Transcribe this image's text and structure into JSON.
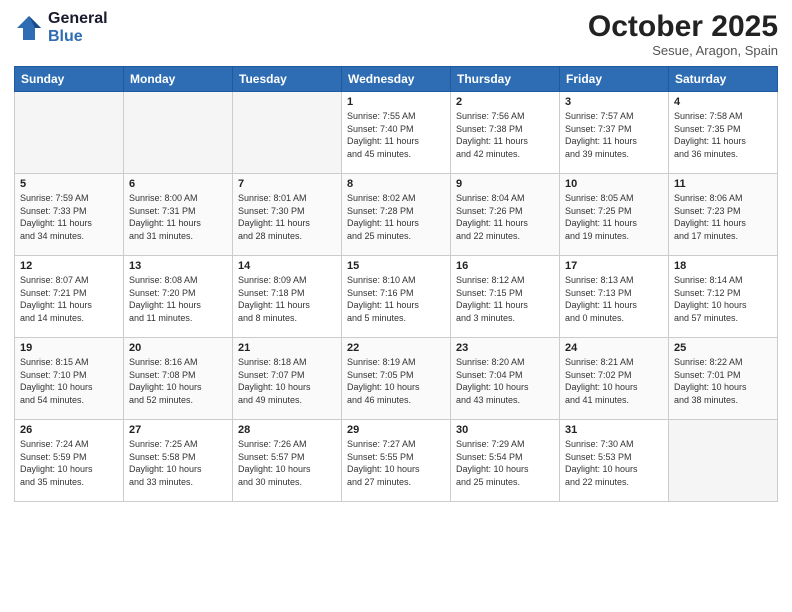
{
  "header": {
    "logo_line1": "General",
    "logo_line2": "Blue",
    "month": "October 2025",
    "location": "Sesue, Aragon, Spain"
  },
  "days_of_week": [
    "Sunday",
    "Monday",
    "Tuesday",
    "Wednesday",
    "Thursday",
    "Friday",
    "Saturday"
  ],
  "weeks": [
    [
      {
        "day": "",
        "info": ""
      },
      {
        "day": "",
        "info": ""
      },
      {
        "day": "",
        "info": ""
      },
      {
        "day": "1",
        "info": "Sunrise: 7:55 AM\nSunset: 7:40 PM\nDaylight: 11 hours\nand 45 minutes."
      },
      {
        "day": "2",
        "info": "Sunrise: 7:56 AM\nSunset: 7:38 PM\nDaylight: 11 hours\nand 42 minutes."
      },
      {
        "day": "3",
        "info": "Sunrise: 7:57 AM\nSunset: 7:37 PM\nDaylight: 11 hours\nand 39 minutes."
      },
      {
        "day": "4",
        "info": "Sunrise: 7:58 AM\nSunset: 7:35 PM\nDaylight: 11 hours\nand 36 minutes."
      }
    ],
    [
      {
        "day": "5",
        "info": "Sunrise: 7:59 AM\nSunset: 7:33 PM\nDaylight: 11 hours\nand 34 minutes."
      },
      {
        "day": "6",
        "info": "Sunrise: 8:00 AM\nSunset: 7:31 PM\nDaylight: 11 hours\nand 31 minutes."
      },
      {
        "day": "7",
        "info": "Sunrise: 8:01 AM\nSunset: 7:30 PM\nDaylight: 11 hours\nand 28 minutes."
      },
      {
        "day": "8",
        "info": "Sunrise: 8:02 AM\nSunset: 7:28 PM\nDaylight: 11 hours\nand 25 minutes."
      },
      {
        "day": "9",
        "info": "Sunrise: 8:04 AM\nSunset: 7:26 PM\nDaylight: 11 hours\nand 22 minutes."
      },
      {
        "day": "10",
        "info": "Sunrise: 8:05 AM\nSunset: 7:25 PM\nDaylight: 11 hours\nand 19 minutes."
      },
      {
        "day": "11",
        "info": "Sunrise: 8:06 AM\nSunset: 7:23 PM\nDaylight: 11 hours\nand 17 minutes."
      }
    ],
    [
      {
        "day": "12",
        "info": "Sunrise: 8:07 AM\nSunset: 7:21 PM\nDaylight: 11 hours\nand 14 minutes."
      },
      {
        "day": "13",
        "info": "Sunrise: 8:08 AM\nSunset: 7:20 PM\nDaylight: 11 hours\nand 11 minutes."
      },
      {
        "day": "14",
        "info": "Sunrise: 8:09 AM\nSunset: 7:18 PM\nDaylight: 11 hours\nand 8 minutes."
      },
      {
        "day": "15",
        "info": "Sunrise: 8:10 AM\nSunset: 7:16 PM\nDaylight: 11 hours\nand 5 minutes."
      },
      {
        "day": "16",
        "info": "Sunrise: 8:12 AM\nSunset: 7:15 PM\nDaylight: 11 hours\nand 3 minutes."
      },
      {
        "day": "17",
        "info": "Sunrise: 8:13 AM\nSunset: 7:13 PM\nDaylight: 11 hours\nand 0 minutes."
      },
      {
        "day": "18",
        "info": "Sunrise: 8:14 AM\nSunset: 7:12 PM\nDaylight: 10 hours\nand 57 minutes."
      }
    ],
    [
      {
        "day": "19",
        "info": "Sunrise: 8:15 AM\nSunset: 7:10 PM\nDaylight: 10 hours\nand 54 minutes."
      },
      {
        "day": "20",
        "info": "Sunrise: 8:16 AM\nSunset: 7:08 PM\nDaylight: 10 hours\nand 52 minutes."
      },
      {
        "day": "21",
        "info": "Sunrise: 8:18 AM\nSunset: 7:07 PM\nDaylight: 10 hours\nand 49 minutes."
      },
      {
        "day": "22",
        "info": "Sunrise: 8:19 AM\nSunset: 7:05 PM\nDaylight: 10 hours\nand 46 minutes."
      },
      {
        "day": "23",
        "info": "Sunrise: 8:20 AM\nSunset: 7:04 PM\nDaylight: 10 hours\nand 43 minutes."
      },
      {
        "day": "24",
        "info": "Sunrise: 8:21 AM\nSunset: 7:02 PM\nDaylight: 10 hours\nand 41 minutes."
      },
      {
        "day": "25",
        "info": "Sunrise: 8:22 AM\nSunset: 7:01 PM\nDaylight: 10 hours\nand 38 minutes."
      }
    ],
    [
      {
        "day": "26",
        "info": "Sunrise: 7:24 AM\nSunset: 5:59 PM\nDaylight: 10 hours\nand 35 minutes."
      },
      {
        "day": "27",
        "info": "Sunrise: 7:25 AM\nSunset: 5:58 PM\nDaylight: 10 hours\nand 33 minutes."
      },
      {
        "day": "28",
        "info": "Sunrise: 7:26 AM\nSunset: 5:57 PM\nDaylight: 10 hours\nand 30 minutes."
      },
      {
        "day": "29",
        "info": "Sunrise: 7:27 AM\nSunset: 5:55 PM\nDaylight: 10 hours\nand 27 minutes."
      },
      {
        "day": "30",
        "info": "Sunrise: 7:29 AM\nSunset: 5:54 PM\nDaylight: 10 hours\nand 25 minutes."
      },
      {
        "day": "31",
        "info": "Sunrise: 7:30 AM\nSunset: 5:53 PM\nDaylight: 10 hours\nand 22 minutes."
      },
      {
        "day": "",
        "info": ""
      }
    ]
  ]
}
